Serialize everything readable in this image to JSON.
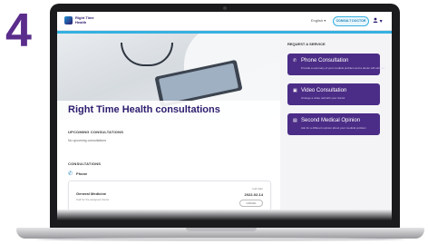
{
  "step_number": "4",
  "header": {
    "logo_text": "Right Time\nHealth",
    "language": "English",
    "consult_button": "CONSULT DOCTOR",
    "user_icon": "user-icon"
  },
  "main": {
    "hero_title": "Right Time Health consultations",
    "upcoming_label": "UPCOMING CONSULTATIONS",
    "upcoming_text": "No upcoming consultations",
    "consultations_label": "CONSULTATIONS",
    "phone_label": "Phone",
    "card": {
      "title": "General Medicine",
      "subtitle": "Call for the assigned doctor",
      "meta": "Call date",
      "date": "2022-02-14",
      "button": "CANCEL"
    }
  },
  "sidebar": {
    "label": "REQUEST A SERVICE",
    "services": [
      {
        "title": "Phone Consultation",
        "description": "Provide a summary of your medical problem and a doctor will call you.",
        "icon": "phone-icon"
      },
      {
        "title": "Video Consultation",
        "description": "Arrange a video call with your doctor",
        "icon": "video-icon"
      },
      {
        "title": "Second Medical Opinion",
        "description": "Ask for a different opinion about your medical problem",
        "icon": "document-icon"
      }
    ]
  },
  "colors": {
    "brand_purple": "#4b2c86",
    "accent_blue": "#36b0e0",
    "step_color": "#5a2d8c"
  }
}
